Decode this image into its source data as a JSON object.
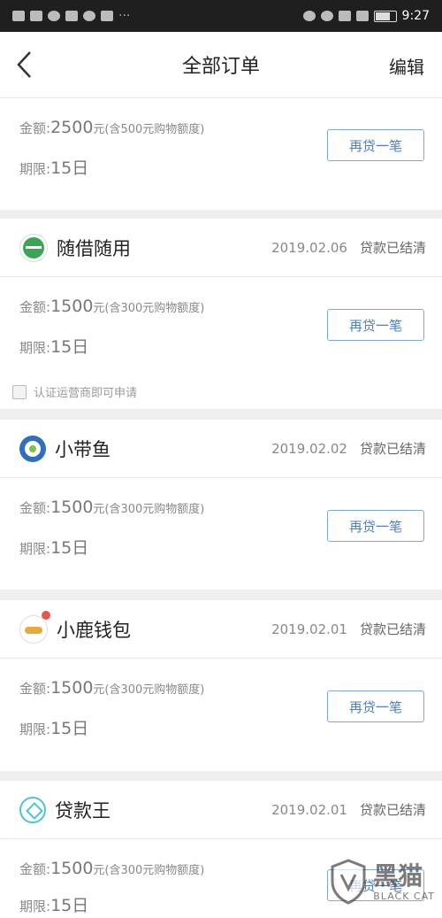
{
  "status_bar": {
    "time": "9:27"
  },
  "navbar": {
    "title": "全部订单",
    "edit_label": "编辑"
  },
  "labels": {
    "amount_prefix": "金额:",
    "term_prefix": "期限:",
    "reloan": "再贷一笔",
    "status_settled": "贷款已结清"
  },
  "orders": [
    {
      "amount": "2500",
      "amount_note": "元(含500元购物额度)",
      "term": "15日"
    },
    {
      "name": "随借随用",
      "date": "2019.02.06",
      "status": "贷款已结清",
      "amount": "1500",
      "amount_note": "元(含300元购物额度)",
      "term": "15日",
      "notice": "认证运营商即可申请"
    },
    {
      "name": "小带鱼",
      "date": "2019.02.02",
      "status": "贷款已结清",
      "amount": "1500",
      "amount_note": "元(含300元购物额度)",
      "term": "15日"
    },
    {
      "name": "小鹿钱包",
      "date": "2019.02.01",
      "status": "贷款已结清",
      "amount": "1500",
      "amount_note": "元(含300元购物额度)",
      "term": "15日"
    },
    {
      "name": "贷款王",
      "date": "2019.02.01",
      "status": "贷款已结清",
      "amount": "1500",
      "amount_note": "元(含300元购物额度)",
      "term": "15日"
    }
  ],
  "watermark": {
    "cn": "黑猫",
    "en": "BLACK CAT"
  },
  "colors": {
    "accent": "#4b7fc0",
    "background": "#efefef"
  }
}
